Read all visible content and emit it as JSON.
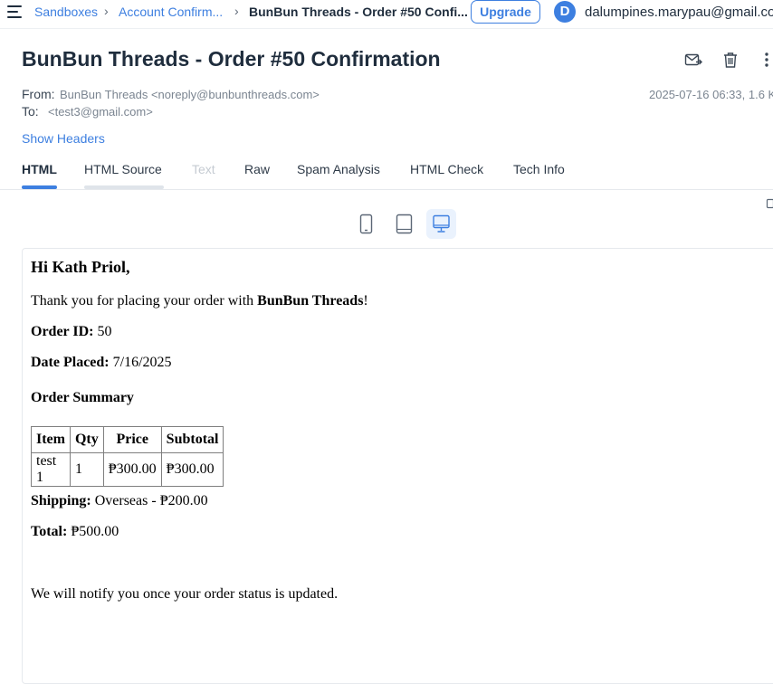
{
  "breadcrumb": {
    "items": [
      "Sandboxes",
      "Account Confirm...",
      "BunBun Threads - Order #50 Confi..."
    ],
    "separator": "›"
  },
  "topbar": {
    "upgrade_label": "Upgrade",
    "avatar_letter": "D",
    "user_email": "dalumpines.marypau@gmail.com"
  },
  "message": {
    "subject": "BunBun Threads - Order #50 Confirmation",
    "from_label": "From:",
    "from_value": "BunBun Threads <noreply@bunbunthreads.com>",
    "to_label": "To:",
    "to_value": "<test3@gmail.com>",
    "date_size": "2025-07-16 06:33, 1.6 K",
    "show_headers": "Show Headers",
    "actions": [
      "forward-mail-icon",
      "trash-icon",
      "more-vertical-icon"
    ]
  },
  "tabs": [
    {
      "label": "HTML",
      "state": "active"
    },
    {
      "label": "HTML Source",
      "state": "normal"
    },
    {
      "label": "Text",
      "state": "disabled"
    },
    {
      "label": "Raw",
      "state": "normal"
    },
    {
      "label": "Spam Analysis",
      "state": "normal"
    },
    {
      "label": "HTML Check",
      "state": "normal"
    },
    {
      "label": "Tech Info",
      "state": "normal"
    }
  ],
  "devices": [
    {
      "icon": "mobile-icon",
      "active": false
    },
    {
      "icon": "tablet-icon",
      "active": false
    },
    {
      "icon": "desktop-icon",
      "active": true
    }
  ],
  "email": {
    "greeting": "Hi Kath Priol,",
    "thanks_prefix": "Thank you for placing your order with ",
    "thanks_brand": "BunBun Threads",
    "thanks_suffix": "!",
    "order_id_label": "Order ID:",
    "order_id_value": " 50",
    "date_label": "Date Placed:",
    "date_value": " 7/16/2025",
    "summary_heading": "Order Summary",
    "table": {
      "headers": [
        "Item",
        "Qty",
        "Price",
        "Subtotal"
      ],
      "rows": [
        [
          "test 1",
          "1",
          "₱300.00",
          "₱300.00"
        ]
      ]
    },
    "shipping_label": "Shipping:",
    "shipping_value": " Overseas - ₱200.00",
    "total_label": "Total:",
    "total_value": " ₱500.00",
    "notify": "We will notify you once your order status is updated."
  },
  "colors": {
    "accent": "#3d7fe0",
    "text": "#1f2d3d",
    "muted": "#7b8591",
    "tab_underline_active": "#3d7fe0",
    "tab_underline_hover": "#dfe4ea",
    "device_active_bg": "#eaf2fd"
  }
}
